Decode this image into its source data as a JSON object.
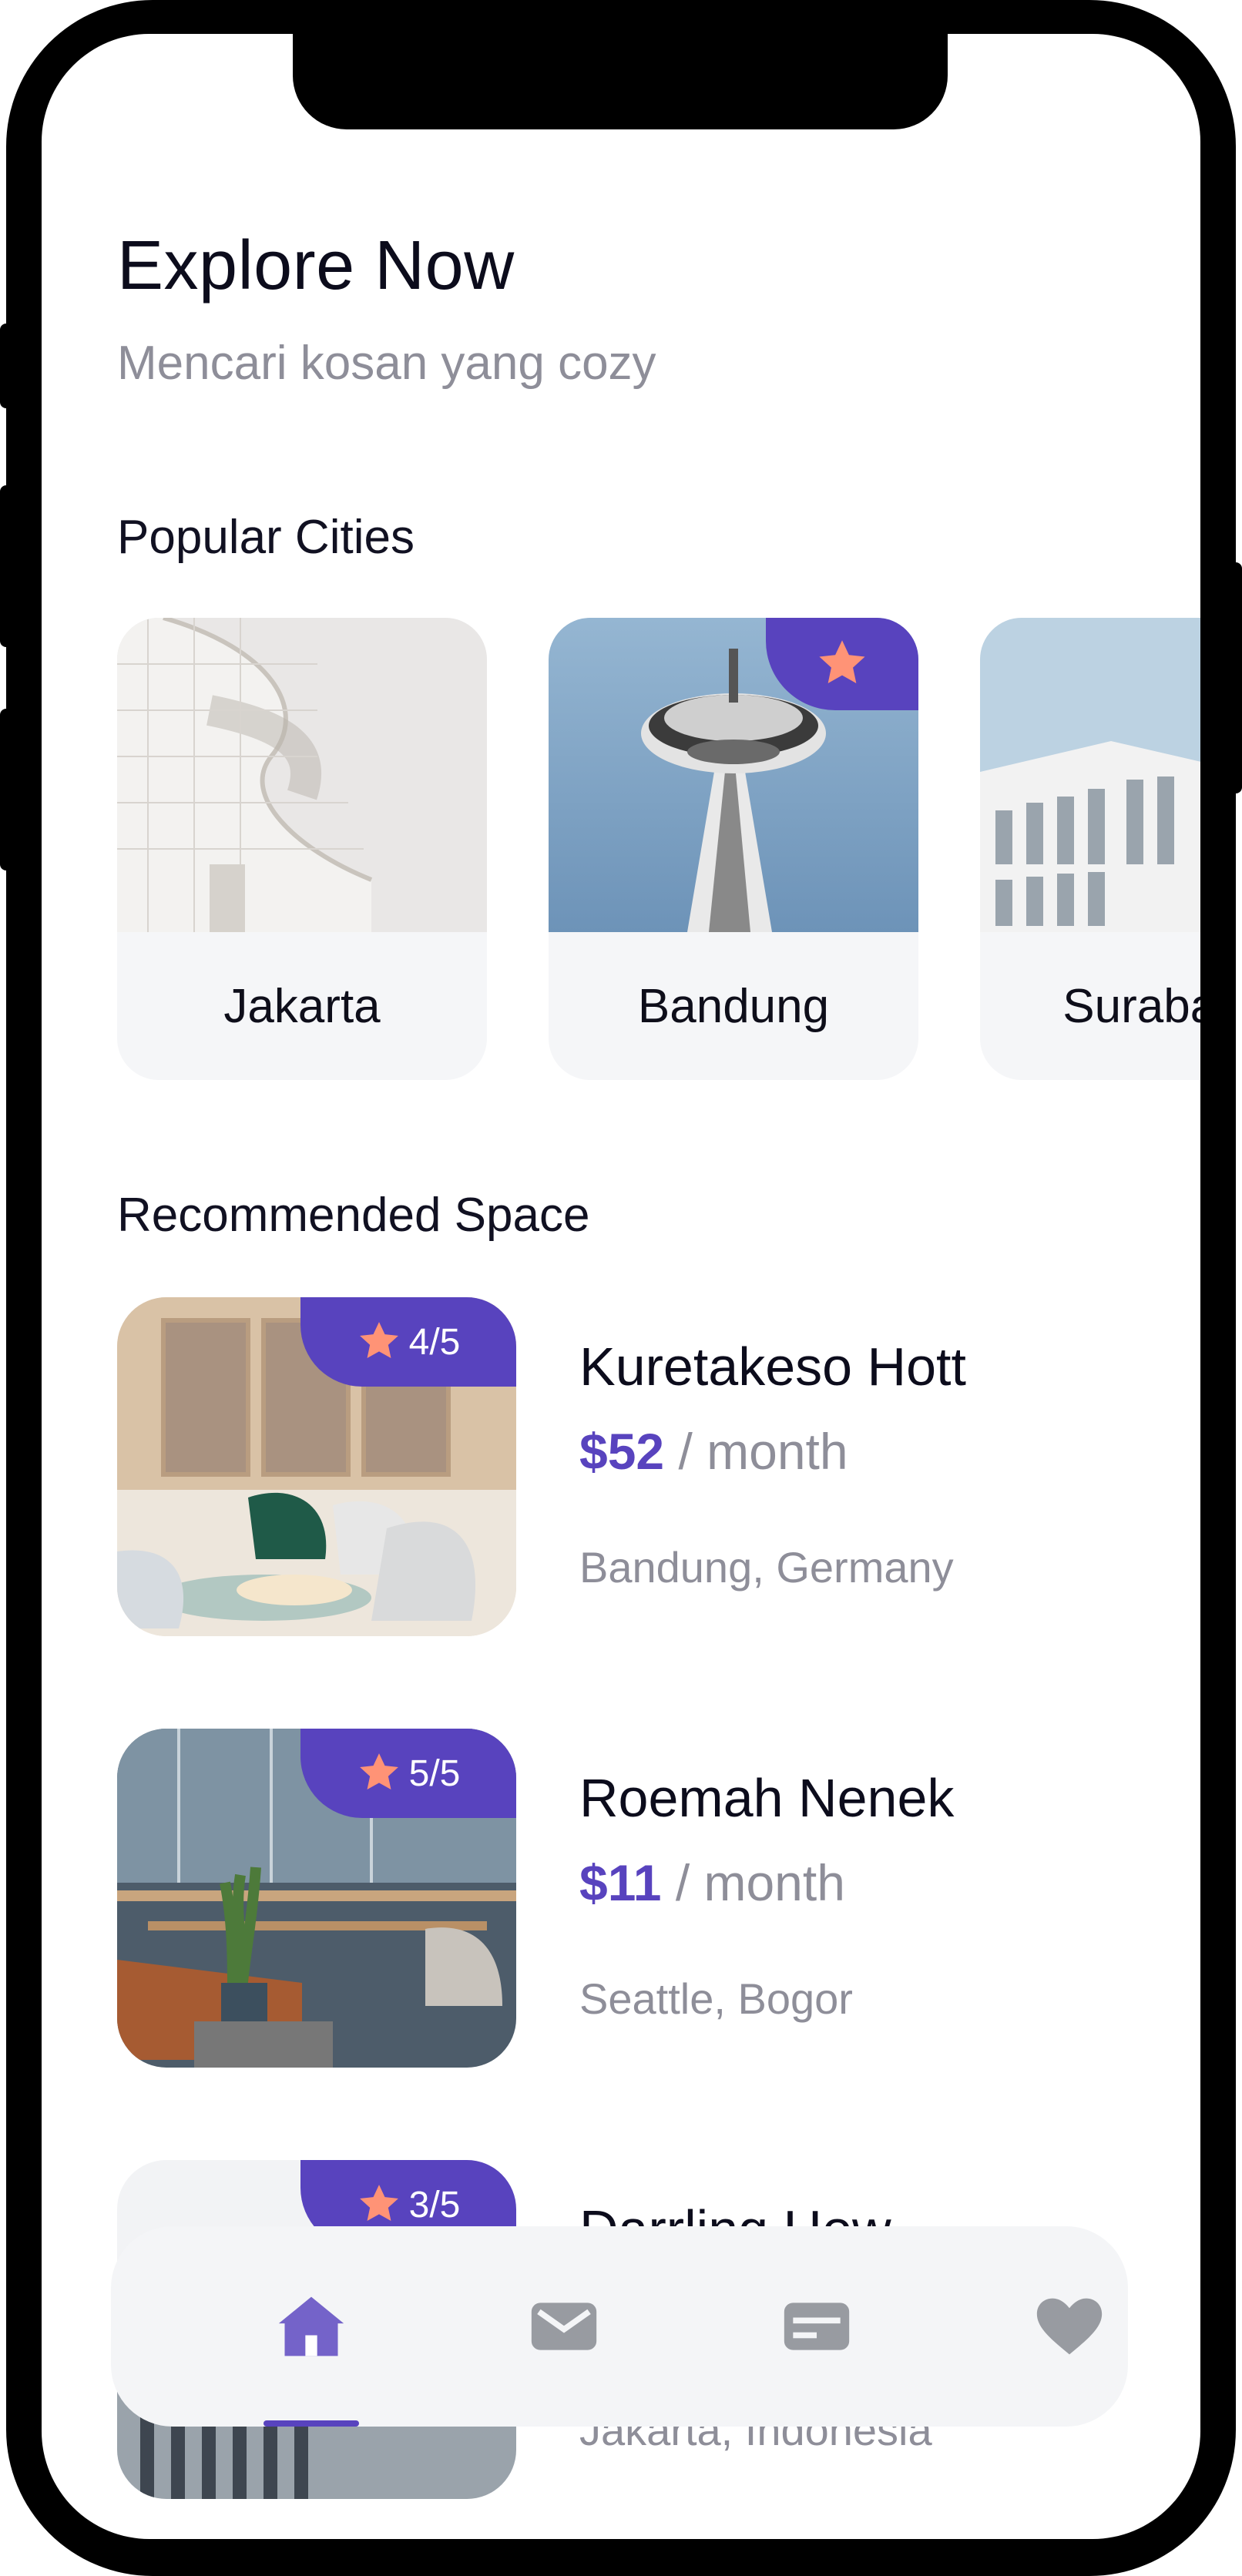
{
  "header": {
    "title": "Explore Now",
    "subtitle": "Mencari kosan yang cozy"
  },
  "popular": {
    "label": "Popular Cities",
    "cities": [
      {
        "name": "Jakarta",
        "favorite": false
      },
      {
        "name": "Bandung",
        "favorite": true
      },
      {
        "name": "Surabaya",
        "favorite": false
      }
    ]
  },
  "recommended": {
    "label": "Recommended Space",
    "items": [
      {
        "name": "Kuretakeso Hott",
        "price": "$52",
        "period": "/ month",
        "location": "Bandung, Germany",
        "rating": "4/5"
      },
      {
        "name": "Roemah Nenek",
        "price": "$11",
        "period": "/ month",
        "location": "Seattle, Bogor",
        "rating": "5/5"
      },
      {
        "name": "Darrling How",
        "price": "",
        "period": "",
        "location": "Jakarta, Indonesia",
        "rating": "3/5"
      }
    ]
  },
  "nav": {
    "items": [
      {
        "icon": "home-icon",
        "active": true
      },
      {
        "icon": "mail-icon",
        "active": false
      },
      {
        "icon": "card-icon",
        "active": false
      },
      {
        "icon": "heart-icon",
        "active": false
      }
    ]
  },
  "colors": {
    "accent": "#5843be",
    "star": "#ff9376",
    "muted": "#8e8e99",
    "inactive_icon": "#989ba1"
  }
}
